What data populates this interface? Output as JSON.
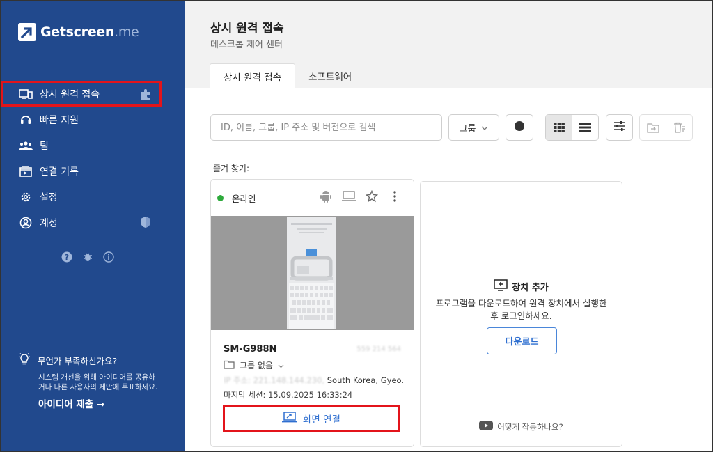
{
  "sidebar": {
    "logo": {
      "name": "Getscreen",
      "suffix": ".me"
    },
    "items": [
      {
        "label": "상시 원격 접속",
        "icon": "monitor-icon",
        "active": true
      },
      {
        "label": "빠른 지원",
        "icon": "headset-icon"
      },
      {
        "label": "팀",
        "icon": "team-icon"
      },
      {
        "label": "연결 기록",
        "icon": "history-icon"
      },
      {
        "label": "설정",
        "icon": "gear-icon"
      },
      {
        "label": "계정",
        "icon": "user-circle-icon"
      }
    ],
    "feedback": {
      "question": "무언가 부족하신가요?",
      "description": "시스템 개선을 위해 아이디어를 공유하거나 다른 사용자의 제안에 투표하세요.",
      "cta": "아이디어 제출 →"
    }
  },
  "header": {
    "title": "상시 원격 접속",
    "subtitle": "데스크톱 제어 센터"
  },
  "tabs": [
    {
      "label": "상시 원격 접속",
      "active": true
    },
    {
      "label": "소프트웨어",
      "active": false
    }
  ],
  "toolbar": {
    "search_placeholder": "ID, 이름, 그룹, IP 주소 및 버전으로 검색",
    "group_label": "그룹"
  },
  "favorites_label": "즐겨 찾기:",
  "device": {
    "status": "온라인",
    "name": "SM-G988N",
    "id_masked": "559 214 564",
    "group": "그룹 없음",
    "ip_prefix": "IP 주소: 221.148.144.230,",
    "location": " South Korea, Gyeo...",
    "last_session": "마지막 세션: 15.09.2025 16:33:24",
    "connect_label": "화면 연결"
  },
  "add_device": {
    "title": "장치 추가",
    "description": "프로그램을 다운로드하여 원격 장치에서 실행한 후 로그인하세요.",
    "download_label": "다운로드",
    "how_label": "어떻게 작동하나요?"
  },
  "colors": {
    "sidebar": "#21498d",
    "accent": "#2f6fd0",
    "highlight": "#e3141b",
    "online": "#2eaa3c"
  }
}
